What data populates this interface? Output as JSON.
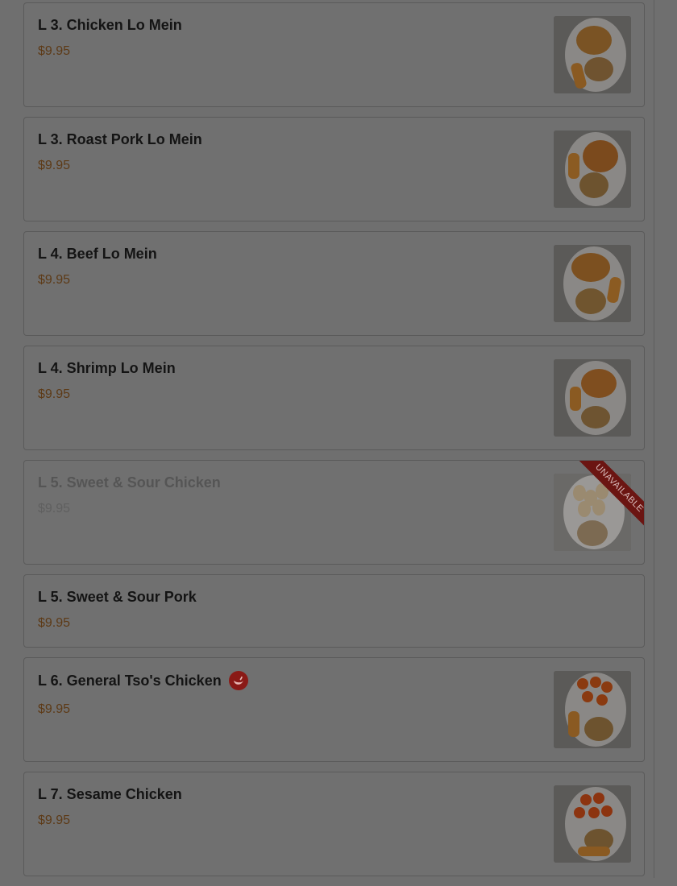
{
  "items": [
    {
      "name": "L 3. Chicken Lo Mein",
      "price": "$9.95",
      "image": "chicken-lo-mein-photo"
    },
    {
      "name": "L 3. Roast Pork Lo Mein",
      "price": "$9.95",
      "image": "roast-pork-lo-mein-photo"
    },
    {
      "name": "L 4. Beef Lo Mein",
      "price": "$9.95",
      "image": "beef-lo-mein-photo"
    },
    {
      "name": "L 4. Shrimp Lo Mein",
      "price": "$9.95",
      "image": "shrimp-lo-mein-photo"
    },
    {
      "name": "L 5. Sweet & Sour Chicken",
      "price": "$9.95",
      "image": "sweet-sour-chicken-photo",
      "badge": "UNAVAILABLE"
    },
    {
      "name": "L 5. Sweet & Sour Pork",
      "price": "$9.95"
    },
    {
      "name": "L 6. General Tso's Chicken",
      "price": "$9.95",
      "image": "general-tsos-chicken-photo",
      "icon": "spicy-pepper-icon"
    },
    {
      "name": "L 7. Sesame Chicken",
      "price": "$9.95",
      "image": "sesame-chicken-photo"
    }
  ],
  "colors": {
    "overlay_bg": "#6f6f6f",
    "price": "#5d3a16",
    "ribbon": "#6b1512",
    "spicy_badge": "#8a1a16"
  }
}
